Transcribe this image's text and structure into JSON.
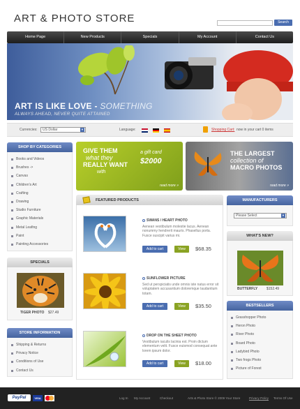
{
  "header": {
    "logo": "ART & PHOTO STORE",
    "search_placeholder": "",
    "search_button": "Search"
  },
  "nav": [
    "Home Page",
    "New Products",
    "Specials",
    "My Account",
    "Contact Us"
  ],
  "banner": {
    "title_bold": "ART IS LIKE LOVE - ",
    "title_light": "SOMETHING",
    "subtitle": "ALWAYS AHEAD, NEVER QUITE ATTAINED"
  },
  "bar": {
    "currencies_label": "Currencies:",
    "currency_value": "US Dollar",
    "language_label": "Language:",
    "cart_link": "Shopping Cart:",
    "cart_text": "now in your cart 0 items"
  },
  "categories": {
    "title": "SHOP BY CATEGORIES",
    "items": [
      "Books and Videos",
      "Brushes ->",
      "Canvas",
      "Children's Art",
      "Crafting",
      "Drawing",
      "Studio Furniture",
      "Graphic Materials",
      "Metal Leafing",
      "Paint",
      "Painting Accessories"
    ]
  },
  "specials": {
    "title": "SPECIALS",
    "name": "TIGER PHOTO",
    "price": "$27.49"
  },
  "store_info": {
    "title": "STORE INFORMATION",
    "items": [
      "Shipping & Returns",
      "Privacy Notice",
      "Conditions of Use",
      "Contact Us"
    ]
  },
  "promo_gift": {
    "line1": "GIVE THEM",
    "line2": "what they",
    "line3": "REALLY WANT",
    "line4": "with",
    "gift_label": "a gift card",
    "gift_amount": "$2000",
    "readmore": "read more »"
  },
  "promo_macro": {
    "line1": "THE LARGEST",
    "line2": "collection of",
    "line3": "MACRO PHOTOS",
    "readmore": "read more »"
  },
  "featured": {
    "title": "FEATURED PRODUCTS",
    "products": [
      {
        "name": "SWANS / HEART PHOTO",
        "desc": "Aenean vestibulum molestie lacus. Aenean nonummy hendrerit mauris. Phasellus porta. Fusce suscipit varius mi.",
        "cart": "Add to cart",
        "view": "View",
        "price": "$68.35"
      },
      {
        "name": "SUNFLOWER PICTURE",
        "desc": "Sed ut perspiciatis unde omnis iste natus error sit voluptatem accusantium doloremque laudantium totam.",
        "cart": "Add to cart",
        "view": "View",
        "price": "$35.50"
      },
      {
        "name": "DROP ON THE SHEET PHOTO",
        "desc": "Vestibulum iaculis lacinia est. Proin dictum elementum velit. Fusce euismod consequat ante lorem ipsum dolor.",
        "cart": "Add to cart",
        "view": "View",
        "price": "$18.00"
      }
    ]
  },
  "manufacturers": {
    "title": "MANUFACTURERS",
    "select": "Please Select"
  },
  "whats_new": {
    "title": "WHAT'S NEW?",
    "name": "BUTTERFLY",
    "price": "$152.49"
  },
  "bestsellers": {
    "title": "BESTSELLERS",
    "items": [
      "Grasshopper Photo",
      "Heron Photo",
      "River Photo",
      "Board Photo",
      "Ladybird Photo",
      "Two frogs Photo",
      "Picture of Forest"
    ]
  },
  "footer": {
    "links": [
      "Log In",
      "My Account",
      "Checkout"
    ],
    "copyright": "Arts & Photo Store © 2009 Your Store",
    "privacy": "Privacy Policy",
    "terms": "Terms Of Use",
    "payments": [
      "PayPal",
      "VISA",
      "MasterCard"
    ]
  },
  "colors": {
    "accent": "#45649f",
    "green": "#8aa323",
    "dark": "#222222"
  }
}
